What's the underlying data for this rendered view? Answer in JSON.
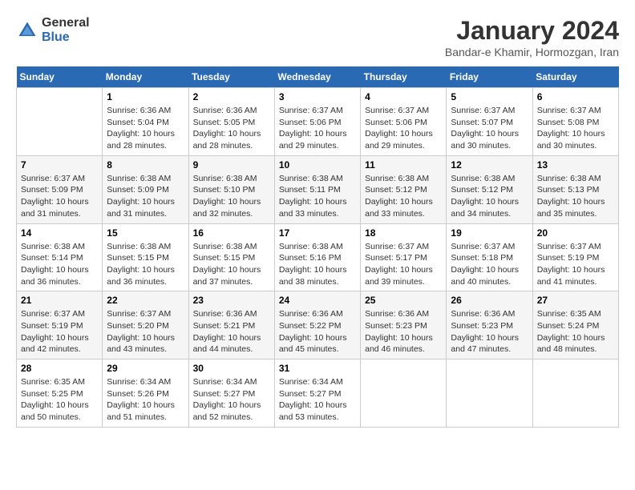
{
  "header": {
    "logo_general": "General",
    "logo_blue": "Blue",
    "title": "January 2024",
    "subtitle": "Bandar-e Khamir, Hormozgan, Iran"
  },
  "calendar": {
    "days_of_week": [
      "Sunday",
      "Monday",
      "Tuesday",
      "Wednesday",
      "Thursday",
      "Friday",
      "Saturday"
    ],
    "weeks": [
      [
        {
          "day": "",
          "sunrise": "",
          "sunset": "",
          "daylight": ""
        },
        {
          "day": "1",
          "sunrise": "Sunrise: 6:36 AM",
          "sunset": "Sunset: 5:04 PM",
          "daylight": "Daylight: 10 hours and 28 minutes."
        },
        {
          "day": "2",
          "sunrise": "Sunrise: 6:36 AM",
          "sunset": "Sunset: 5:05 PM",
          "daylight": "Daylight: 10 hours and 28 minutes."
        },
        {
          "day": "3",
          "sunrise": "Sunrise: 6:37 AM",
          "sunset": "Sunset: 5:06 PM",
          "daylight": "Daylight: 10 hours and 29 minutes."
        },
        {
          "day": "4",
          "sunrise": "Sunrise: 6:37 AM",
          "sunset": "Sunset: 5:06 PM",
          "daylight": "Daylight: 10 hours and 29 minutes."
        },
        {
          "day": "5",
          "sunrise": "Sunrise: 6:37 AM",
          "sunset": "Sunset: 5:07 PM",
          "daylight": "Daylight: 10 hours and 30 minutes."
        },
        {
          "day": "6",
          "sunrise": "Sunrise: 6:37 AM",
          "sunset": "Sunset: 5:08 PM",
          "daylight": "Daylight: 10 hours and 30 minutes."
        }
      ],
      [
        {
          "day": "7",
          "sunrise": "Sunrise: 6:37 AM",
          "sunset": "Sunset: 5:09 PM",
          "daylight": "Daylight: 10 hours and 31 minutes."
        },
        {
          "day": "8",
          "sunrise": "Sunrise: 6:38 AM",
          "sunset": "Sunset: 5:09 PM",
          "daylight": "Daylight: 10 hours and 31 minutes."
        },
        {
          "day": "9",
          "sunrise": "Sunrise: 6:38 AM",
          "sunset": "Sunset: 5:10 PM",
          "daylight": "Daylight: 10 hours and 32 minutes."
        },
        {
          "day": "10",
          "sunrise": "Sunrise: 6:38 AM",
          "sunset": "Sunset: 5:11 PM",
          "daylight": "Daylight: 10 hours and 33 minutes."
        },
        {
          "day": "11",
          "sunrise": "Sunrise: 6:38 AM",
          "sunset": "Sunset: 5:12 PM",
          "daylight": "Daylight: 10 hours and 33 minutes."
        },
        {
          "day": "12",
          "sunrise": "Sunrise: 6:38 AM",
          "sunset": "Sunset: 5:12 PM",
          "daylight": "Daylight: 10 hours and 34 minutes."
        },
        {
          "day": "13",
          "sunrise": "Sunrise: 6:38 AM",
          "sunset": "Sunset: 5:13 PM",
          "daylight": "Daylight: 10 hours and 35 minutes."
        }
      ],
      [
        {
          "day": "14",
          "sunrise": "Sunrise: 6:38 AM",
          "sunset": "Sunset: 5:14 PM",
          "daylight": "Daylight: 10 hours and 36 minutes."
        },
        {
          "day": "15",
          "sunrise": "Sunrise: 6:38 AM",
          "sunset": "Sunset: 5:15 PM",
          "daylight": "Daylight: 10 hours and 36 minutes."
        },
        {
          "day": "16",
          "sunrise": "Sunrise: 6:38 AM",
          "sunset": "Sunset: 5:15 PM",
          "daylight": "Daylight: 10 hours and 37 minutes."
        },
        {
          "day": "17",
          "sunrise": "Sunrise: 6:38 AM",
          "sunset": "Sunset: 5:16 PM",
          "daylight": "Daylight: 10 hours and 38 minutes."
        },
        {
          "day": "18",
          "sunrise": "Sunrise: 6:37 AM",
          "sunset": "Sunset: 5:17 PM",
          "daylight": "Daylight: 10 hours and 39 minutes."
        },
        {
          "day": "19",
          "sunrise": "Sunrise: 6:37 AM",
          "sunset": "Sunset: 5:18 PM",
          "daylight": "Daylight: 10 hours and 40 minutes."
        },
        {
          "day": "20",
          "sunrise": "Sunrise: 6:37 AM",
          "sunset": "Sunset: 5:19 PM",
          "daylight": "Daylight: 10 hours and 41 minutes."
        }
      ],
      [
        {
          "day": "21",
          "sunrise": "Sunrise: 6:37 AM",
          "sunset": "Sunset: 5:19 PM",
          "daylight": "Daylight: 10 hours and 42 minutes."
        },
        {
          "day": "22",
          "sunrise": "Sunrise: 6:37 AM",
          "sunset": "Sunset: 5:20 PM",
          "daylight": "Daylight: 10 hours and 43 minutes."
        },
        {
          "day": "23",
          "sunrise": "Sunrise: 6:36 AM",
          "sunset": "Sunset: 5:21 PM",
          "daylight": "Daylight: 10 hours and 44 minutes."
        },
        {
          "day": "24",
          "sunrise": "Sunrise: 6:36 AM",
          "sunset": "Sunset: 5:22 PM",
          "daylight": "Daylight: 10 hours and 45 minutes."
        },
        {
          "day": "25",
          "sunrise": "Sunrise: 6:36 AM",
          "sunset": "Sunset: 5:23 PM",
          "daylight": "Daylight: 10 hours and 46 minutes."
        },
        {
          "day": "26",
          "sunrise": "Sunrise: 6:36 AM",
          "sunset": "Sunset: 5:23 PM",
          "daylight": "Daylight: 10 hours and 47 minutes."
        },
        {
          "day": "27",
          "sunrise": "Sunrise: 6:35 AM",
          "sunset": "Sunset: 5:24 PM",
          "daylight": "Daylight: 10 hours and 48 minutes."
        }
      ],
      [
        {
          "day": "28",
          "sunrise": "Sunrise: 6:35 AM",
          "sunset": "Sunset: 5:25 PM",
          "daylight": "Daylight: 10 hours and 50 minutes."
        },
        {
          "day": "29",
          "sunrise": "Sunrise: 6:34 AM",
          "sunset": "Sunset: 5:26 PM",
          "daylight": "Daylight: 10 hours and 51 minutes."
        },
        {
          "day": "30",
          "sunrise": "Sunrise: 6:34 AM",
          "sunset": "Sunset: 5:27 PM",
          "daylight": "Daylight: 10 hours and 52 minutes."
        },
        {
          "day": "31",
          "sunrise": "Sunrise: 6:34 AM",
          "sunset": "Sunset: 5:27 PM",
          "daylight": "Daylight: 10 hours and 53 minutes."
        },
        {
          "day": "",
          "sunrise": "",
          "sunset": "",
          "daylight": ""
        },
        {
          "day": "",
          "sunrise": "",
          "sunset": "",
          "daylight": ""
        },
        {
          "day": "",
          "sunrise": "",
          "sunset": "",
          "daylight": ""
        }
      ]
    ]
  }
}
